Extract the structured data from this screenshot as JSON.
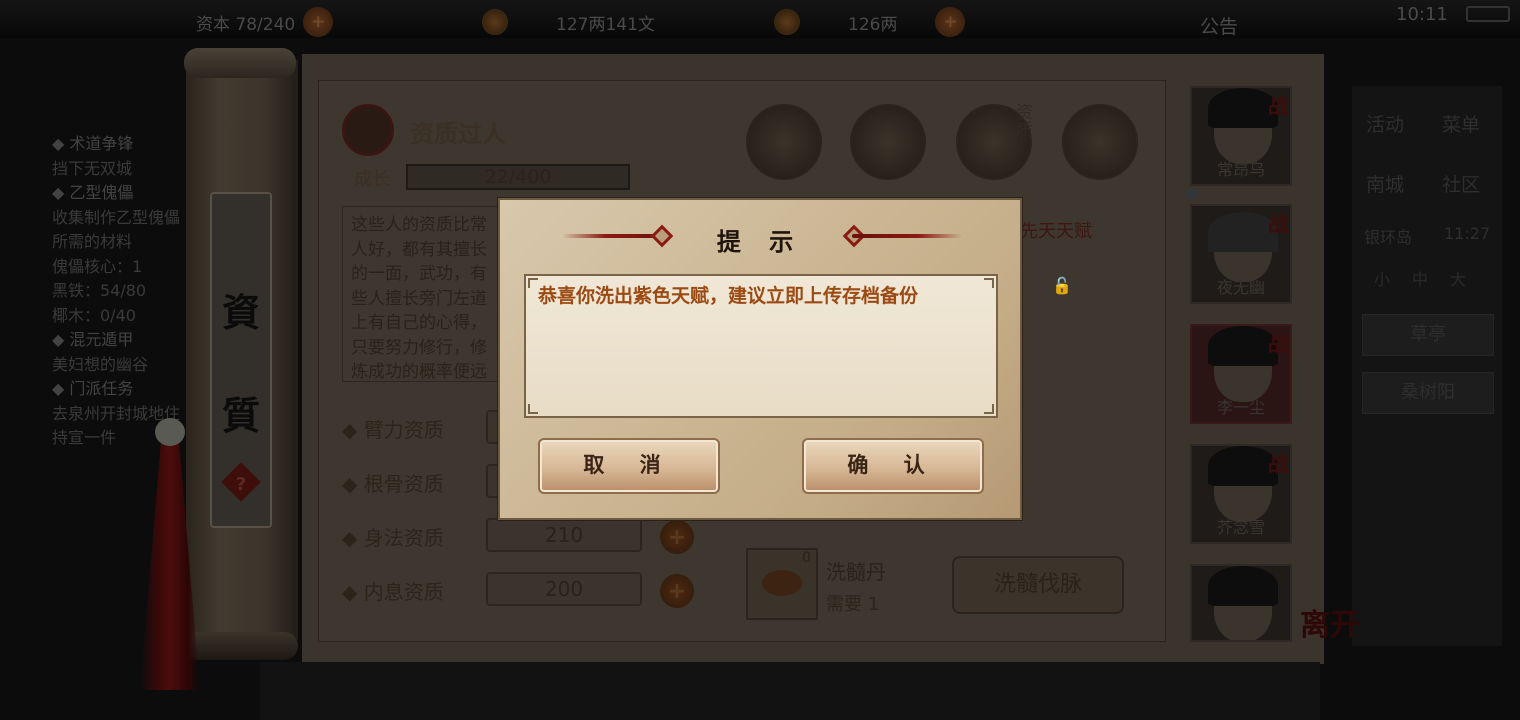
{
  "topbar": {
    "res1": "资本 78/240",
    "res2": "127两141文",
    "res3": "126两",
    "notice": "公告",
    "clock": "10:11"
  },
  "quest_log": [
    {
      "head": "◆ 术道争锋",
      "body": "挡下无双城"
    },
    {
      "head": "◆ 乙型傀儡",
      "body": "收集制作乙型傀儡所需的材料"
    },
    {
      "head": "",
      "body": "傀儡核心：1"
    },
    {
      "head": "",
      "body": "黑铁：54/80"
    },
    {
      "head": "",
      "body": "椰木：0/40"
    },
    {
      "head": "◆ 混元遁甲",
      "body": "美妇想的幽谷"
    },
    {
      "head": "◆ 门派任务",
      "body": "去泉州开封城地住持宣一件"
    }
  ],
  "scroll": {
    "label_top": "資",
    "label_bottom": "質",
    "help": "?"
  },
  "talent": {
    "title": "资质过人",
    "growth_label": "成长",
    "growth_value": "22/400",
    "description": "这些人的资质比常人好，都有其擅长的一面，武功，有些人擅长旁门左道上有自己的心得，只要努力修行，修炼成功的概率便远高于常人。"
  },
  "stats": [
    {
      "label": "◆ 臂力资质",
      "value": ""
    },
    {
      "label": "◆ 根骨资质",
      "value": ""
    },
    {
      "label": "◆ 身法资质",
      "value": "210"
    },
    {
      "label": "◆ 内息资质",
      "value": "200"
    }
  ],
  "categories": [
    "hat",
    "scroll",
    "资质",
    "body"
  ],
  "xiantian_label": "先天天赋",
  "item": {
    "name": "洗髓丹",
    "need": "需要 1",
    "count": "0"
  },
  "refine_button": "洗髓伐脉",
  "characters": [
    {
      "name": "常昂乌",
      "tag": "战"
    },
    {
      "name": "夜无幽",
      "tag": "战"
    },
    {
      "name": "李一尘",
      "tag": "战"
    },
    {
      "name": "芥念雪",
      "tag": "战"
    },
    {
      "name": "",
      "tag": ""
    }
  ],
  "xiu_tag": "修",
  "right_menu": {
    "row1": [
      "活动",
      "菜单"
    ],
    "row2": [
      "南城",
      "社区"
    ],
    "location": "银环岛",
    "time": "11:27",
    "small": [
      "小",
      "中",
      "大"
    ],
    "btn1": "草亭",
    "btn2": "桑树阳"
  },
  "leave_label": "离开",
  "dialog": {
    "title": "提 示",
    "message": "恭喜你洗出紫色天赋，建议立即上传存档备份",
    "cancel": "取 消",
    "confirm": "确 认"
  },
  "colors": {
    "dialog_text": "#9c4a14",
    "dialog_bg": "#d8c8ac",
    "ornament": "#8a1a12"
  }
}
